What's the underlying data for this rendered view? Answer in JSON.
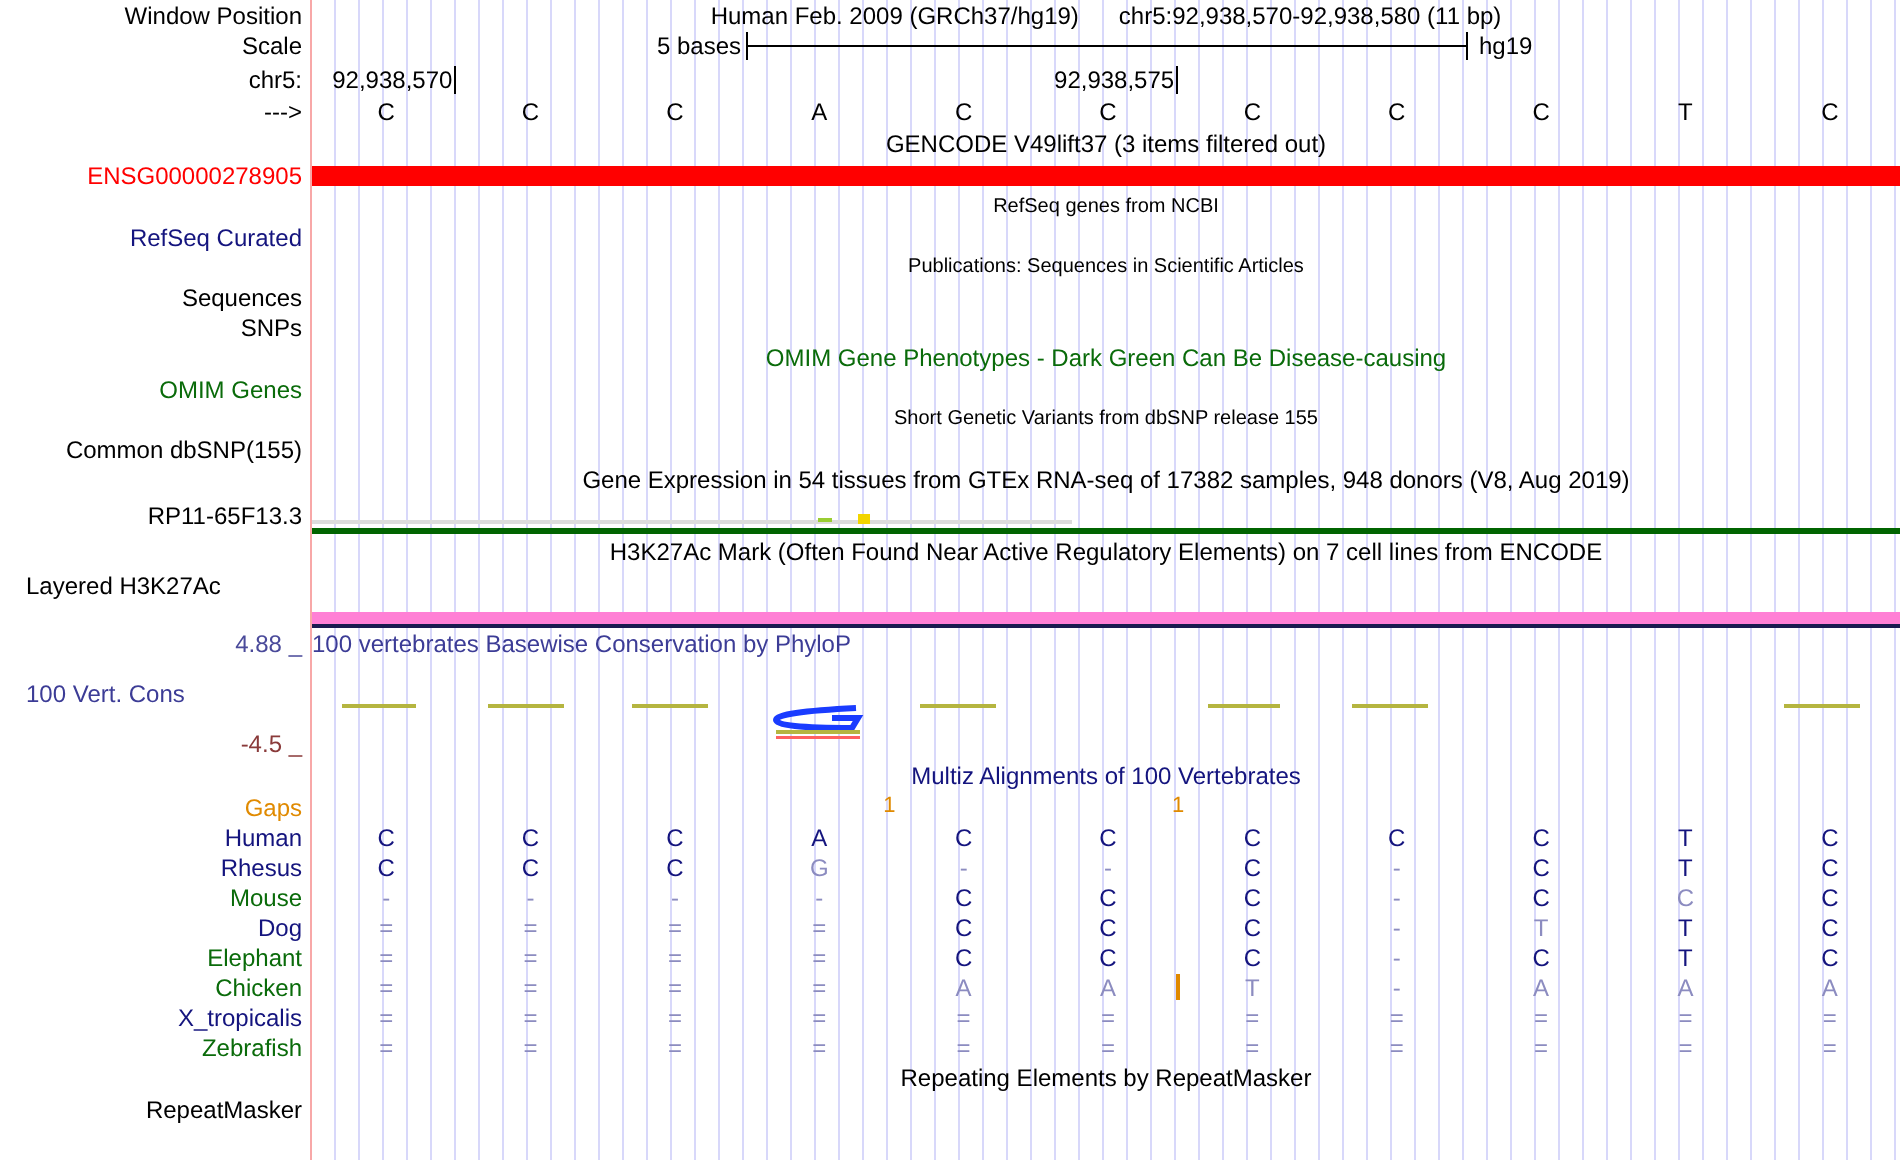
{
  "header": {
    "label": "Window Position",
    "assembly": "Human Feb. 2009 (GRCh37/hg19)",
    "position": "chr5:92,938,570-92,938,580 (11 bp)"
  },
  "scale": {
    "label": "Scale",
    "length": "5 bases",
    "assembly": "hg19"
  },
  "ruler": {
    "label": "chr5:",
    "ticks": [
      "92,938,570",
      "92,938,575"
    ]
  },
  "sequence": {
    "label": "--->",
    "bases": [
      "C",
      "C",
      "C",
      "A",
      "C",
      "C",
      "C",
      "C",
      "C",
      "T",
      "C"
    ]
  },
  "tracks": [
    {
      "kind": "title",
      "text": "GENCODE V49lift37 (3 items filtered out)",
      "color": "#000000"
    },
    {
      "kind": "bar",
      "label": "ENSG00000278905",
      "color": "#ff0000"
    },
    {
      "kind": "subtitle",
      "text": "RefSeq genes from NCBI"
    },
    {
      "kind": "label",
      "label": "RefSeq Curated",
      "color": "#14147e"
    },
    {
      "kind": "subtitle",
      "text": "Publications: Sequences in Scientific Articles"
    },
    {
      "kind": "label",
      "label": "Sequences",
      "color": "#000000"
    },
    {
      "kind": "label",
      "label": "SNPs",
      "color": "#000000"
    },
    {
      "kind": "title",
      "text": "OMIM Gene Phenotypes - Dark Green Can Be Disease-causing",
      "color": "#0a6b0a"
    },
    {
      "kind": "label",
      "label": "OMIM Genes",
      "color": "#0a6b0a"
    },
    {
      "kind": "subtitle",
      "text": "Short Genetic Variants from dbSNP release 155"
    },
    {
      "kind": "label",
      "label": "Common dbSNP(155)",
      "color": "#000000"
    },
    {
      "kind": "title",
      "text": "Gene Expression in 54 tissues from GTEx RNA-seq of 17382 samples, 948 donors (V8, Aug 2019)",
      "color": "#000000"
    },
    {
      "kind": "expression",
      "label": "RP11-65F13.3"
    },
    {
      "kind": "title",
      "text": "H3K27Ac Mark (Often Found Near Active Regulatory Elements) on 7 cell lines from ENCODE",
      "color": "#000000"
    },
    {
      "kind": "caption",
      "label": "Layered H3K27Ac",
      "color": "#000000"
    },
    {
      "kind": "signal",
      "color": "#ff80d5"
    },
    {
      "kind": "conservation",
      "title": "100 vertebrates Basewise Conservation by PhyloP",
      "max": "4.88 _",
      "label": "100 Vert. Cons",
      "min": "-4.5 _"
    },
    {
      "kind": "title",
      "text": "Multiz Alignments of 100 Vertebrates",
      "color": "#14147e"
    },
    {
      "kind": "gaps",
      "label": "Gaps",
      "marks": [
        {
          "count": "1"
        },
        {
          "count": "1"
        }
      ]
    },
    {
      "kind": "alignment",
      "rows": [
        {
          "species": "Human",
          "color": "#14147e",
          "bases": [
            {
              "letter": "C",
              "faded": false
            },
            {
              "letter": "C",
              "faded": false
            },
            {
              "letter": "C",
              "faded": false
            },
            {
              "letter": "A",
              "faded": false
            },
            {
              "letter": "C",
              "faded": false
            },
            {
              "letter": "C",
              "faded": false
            },
            {
              "letter": "C",
              "faded": false
            },
            {
              "letter": "C",
              "faded": false
            },
            {
              "letter": "C",
              "faded": false
            },
            {
              "letter": "T",
              "faded": false
            },
            {
              "letter": "C",
              "faded": false
            }
          ]
        },
        {
          "species": "Rhesus",
          "color": "#14147e",
          "bases": [
            {
              "letter": "C",
              "faded": false
            },
            {
              "letter": "C",
              "faded": false
            },
            {
              "letter": "C",
              "faded": false
            },
            {
              "letter": "G",
              "faded": true
            },
            {
              "letter": "-",
              "faded": true
            },
            {
              "letter": "-",
              "faded": true
            },
            {
              "letter": "C",
              "faded": false
            },
            {
              "letter": "-",
              "faded": true
            },
            {
              "letter": "C",
              "faded": false
            },
            {
              "letter": "T",
              "faded": false
            },
            {
              "letter": "C",
              "faded": false
            }
          ]
        },
        {
          "species": "Mouse",
          "color": "#0a6b0a",
          "bases": [
            {
              "letter": "-",
              "faded": true
            },
            {
              "letter": "-",
              "faded": true
            },
            {
              "letter": "-",
              "faded": true
            },
            {
              "letter": "-",
              "faded": true
            },
            {
              "letter": "C",
              "faded": false
            },
            {
              "letter": "C",
              "faded": false
            },
            {
              "letter": "C",
              "faded": false
            },
            {
              "letter": "-",
              "faded": true
            },
            {
              "letter": "C",
              "faded": false
            },
            {
              "letter": "C",
              "faded": true
            },
            {
              "letter": "C",
              "faded": false
            }
          ]
        },
        {
          "species": "Dog",
          "color": "#14147e",
          "bases": [
            {
              "letter": "=",
              "faded": true
            },
            {
              "letter": "=",
              "faded": true
            },
            {
              "letter": "=",
              "faded": true
            },
            {
              "letter": "=",
              "faded": true
            },
            {
              "letter": "C",
              "faded": false
            },
            {
              "letter": "C",
              "faded": false
            },
            {
              "letter": "C",
              "faded": false
            },
            {
              "letter": "-",
              "faded": true
            },
            {
              "letter": "T",
              "faded": true
            },
            {
              "letter": "T",
              "faded": false
            },
            {
              "letter": "C",
              "faded": false
            }
          ]
        },
        {
          "species": "Elephant",
          "color": "#0a6b0a",
          "bases": [
            {
              "letter": "=",
              "faded": true
            },
            {
              "letter": "=",
              "faded": true
            },
            {
              "letter": "=",
              "faded": true
            },
            {
              "letter": "=",
              "faded": true
            },
            {
              "letter": "C",
              "faded": false
            },
            {
              "letter": "C",
              "faded": false
            },
            {
              "letter": "C",
              "faded": false
            },
            {
              "letter": "-",
              "faded": true
            },
            {
              "letter": "C",
              "faded": false
            },
            {
              "letter": "T",
              "faded": false
            },
            {
              "letter": "C",
              "faded": false
            }
          ]
        },
        {
          "species": "Chicken",
          "color": "#0a6b0a",
          "insertion": true,
          "bases": [
            {
              "letter": "=",
              "faded": true
            },
            {
              "letter": "=",
              "faded": true
            },
            {
              "letter": "=",
              "faded": true
            },
            {
              "letter": "=",
              "faded": true
            },
            {
              "letter": "A",
              "faded": true
            },
            {
              "letter": "A",
              "faded": true
            },
            {
              "letter": "T",
              "faded": true
            },
            {
              "letter": "-",
              "faded": true
            },
            {
              "letter": "A",
              "faded": true
            },
            {
              "letter": "A",
              "faded": true
            },
            {
              "letter": "A",
              "faded": true
            }
          ]
        },
        {
          "species": "X_tropicalis",
          "color": "#14147e",
          "bases": [
            {
              "letter": "=",
              "faded": true
            },
            {
              "letter": "=",
              "faded": true
            },
            {
              "letter": "=",
              "faded": true
            },
            {
              "letter": "=",
              "faded": true
            },
            {
              "letter": "=",
              "faded": true
            },
            {
              "letter": "=",
              "faded": true
            },
            {
              "letter": "=",
              "faded": true
            },
            {
              "letter": "=",
              "faded": true
            },
            {
              "letter": "=",
              "faded": true
            },
            {
              "letter": "=",
              "faded": true
            },
            {
              "letter": "=",
              "faded": true
            }
          ]
        },
        {
          "species": "Zebrafish",
          "color": "#0a6b0a",
          "bases": [
            {
              "letter": "=",
              "faded": true
            },
            {
              "letter": "=",
              "faded": true
            },
            {
              "letter": "=",
              "faded": true
            },
            {
              "letter": "=",
              "faded": true
            },
            {
              "letter": "=",
              "faded": true
            },
            {
              "letter": "=",
              "faded": true
            },
            {
              "letter": "=",
              "faded": true
            },
            {
              "letter": "=",
              "faded": true
            },
            {
              "letter": "=",
              "faded": true
            },
            {
              "letter": "=",
              "faded": true
            },
            {
              "letter": "=",
              "faded": true
            }
          ]
        }
      ]
    },
    {
      "kind": "title",
      "text": "Repeating Elements by RepeatMasker",
      "color": "#000000"
    },
    {
      "kind": "label",
      "label": "RepeatMasker",
      "color": "#000000"
    }
  ]
}
